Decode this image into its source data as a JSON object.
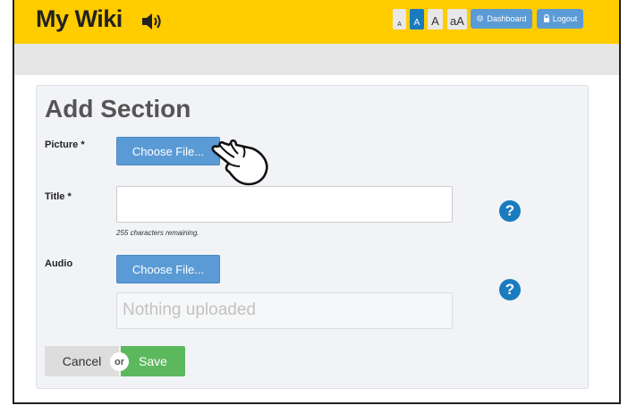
{
  "app": {
    "title": "My Wiki"
  },
  "header": {
    "font_sizes": [
      "A",
      "A",
      "A",
      "aA"
    ],
    "dashboard_label": "Dashboard",
    "logout_label": "Logout"
  },
  "form": {
    "heading": "Add Section",
    "picture_label": "Picture *",
    "choose_file_label": "Choose File...",
    "title_label": "Title *",
    "title_value": "",
    "chars_remaining": "255 characters remaining.",
    "audio_label": "Audio",
    "audio_choose_label": "Choose File...",
    "audio_status": "Nothing uploaded",
    "cancel_label": "Cancel",
    "or_label": "or",
    "save_label": "Save",
    "help_glyph": "?"
  },
  "colors": {
    "topbar": "#ffcc00",
    "primary": "#5b9bd5",
    "save": "#5cb85c",
    "help": "#1a7bbf"
  },
  "icons": [
    "speaker-icon",
    "gear-icon",
    "lock-icon",
    "help-icon",
    "pointer-hand-icon"
  ]
}
